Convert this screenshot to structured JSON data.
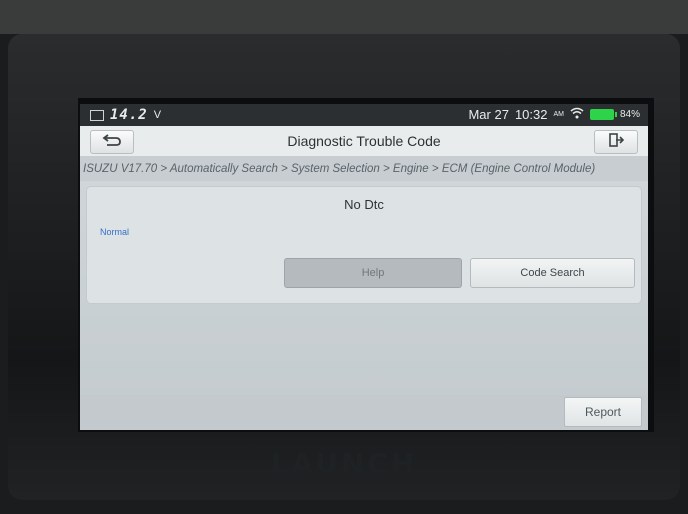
{
  "status_bar": {
    "voltage": "14.2",
    "voltage_unit": "V",
    "date": "Mar 27",
    "time": "10:32",
    "ampm": "AM",
    "battery_percent": "84%",
    "battery_color": "#2fd34a"
  },
  "header": {
    "title": "Diagnostic Trouble Code",
    "back_icon": "back-arrow-icon",
    "exit_icon": "exit-door-icon"
  },
  "breadcrumb": "ISUZU V17.70 > Automatically Search > System Selection > Engine > ECM (Engine Control Module)",
  "main": {
    "dtc_status": "No Dtc",
    "system_state": "Normal",
    "help_label": "Help",
    "code_search_label": "Code Search"
  },
  "footer": {
    "report_label": "Report"
  },
  "device_brand": "LAUNCH"
}
